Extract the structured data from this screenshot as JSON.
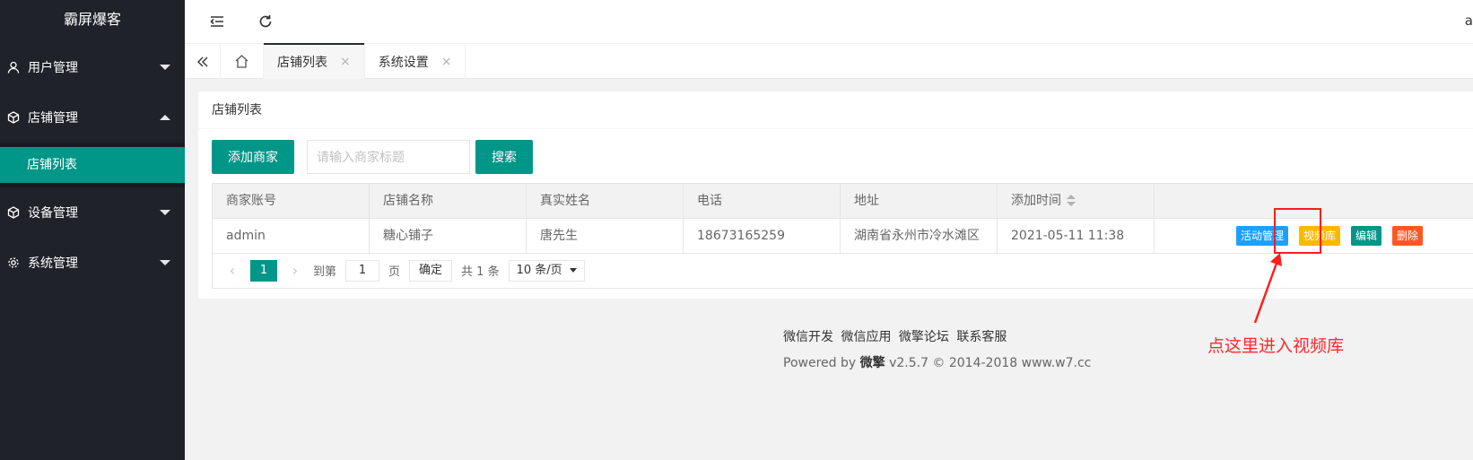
{
  "sidebar": {
    "logo": "霸屏爆客",
    "items": [
      {
        "label": "用户管理",
        "icon": "user-icon",
        "expanded": false
      },
      {
        "label": "店铺管理",
        "icon": "cube-icon",
        "expanded": true,
        "children": [
          {
            "label": "店铺列表"
          }
        ]
      },
      {
        "label": "设备管理",
        "icon": "cube-icon",
        "expanded": false
      },
      {
        "label": "系统管理",
        "icon": "gear-icon",
        "expanded": false
      }
    ]
  },
  "header": {
    "user_initial": "a"
  },
  "tabs": [
    {
      "label": "店铺列表",
      "close": "×",
      "active": true
    },
    {
      "label": "系统设置",
      "close": "×",
      "active": false
    }
  ],
  "card": {
    "title": "店铺列表",
    "add_button": "添加商家",
    "search_placeholder": "请输入商家标题",
    "search_button": "搜索"
  },
  "table": {
    "columns": [
      "商家账号",
      "店铺名称",
      "真实姓名",
      "电话",
      "地址",
      "添加时间",
      ""
    ],
    "rows": [
      {
        "account": "admin",
        "shop_name": "糖心铺子",
        "real_name": "唐先生",
        "phone": "18673165259",
        "address": "湖南省永州市冷水滩区",
        "added": "2021-05-11 11:38",
        "actions": [
          "活动管理",
          "视频库",
          "编辑",
          "删除"
        ]
      }
    ]
  },
  "pager": {
    "prev": "‹",
    "current": "1",
    "next": "›",
    "goto": "到第",
    "goto_value": "1",
    "page_unit": "页",
    "ok": "确定",
    "total": "共 1 条",
    "page_size": "10 条/页"
  },
  "footer": {
    "links": [
      "微信开发",
      "微信应用",
      "微擎论坛",
      "联系客服"
    ],
    "powered_prefix": "Powered by",
    "powered_brand": "微擎",
    "powered_suffix": "v2.5.7 © 2014-2018 www.w7.cc"
  },
  "annotation": {
    "text": "点这里进入视频库",
    "color": "#ff2a2a"
  },
  "colors": {
    "primary": "#009688",
    "sidebar_bg": "#20222a",
    "blue": "#1e9fff",
    "yellow": "#ffb800",
    "red": "#ff5722"
  }
}
